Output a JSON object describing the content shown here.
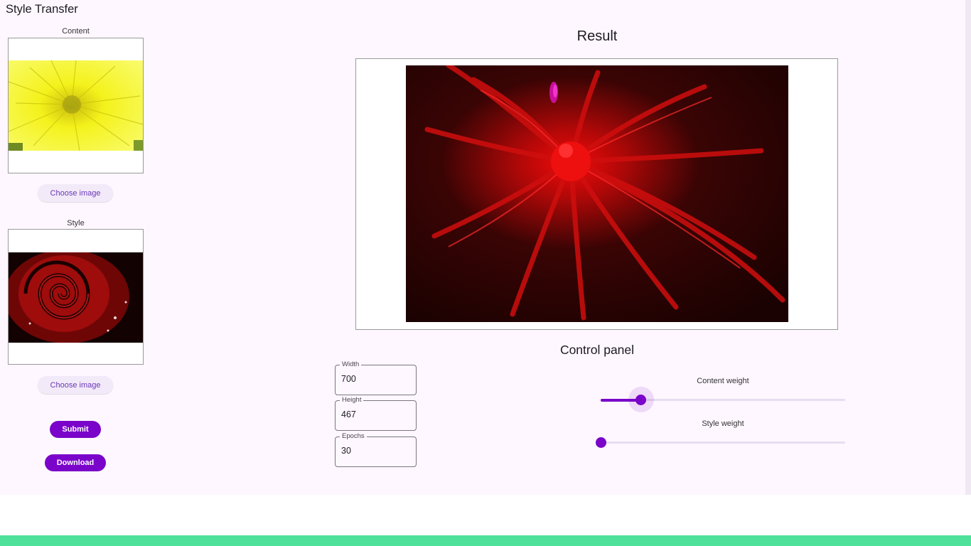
{
  "app": {
    "title": "Style Transfer"
  },
  "content": {
    "label": "Content",
    "choose_label": "Choose image"
  },
  "style": {
    "label": "Style",
    "choose_label": "Choose image"
  },
  "actions": {
    "submit_label": "Submit",
    "download_label": "Download"
  },
  "result": {
    "title": "Result"
  },
  "control_panel": {
    "title": "Control panel",
    "fields": {
      "width": {
        "label": "Width",
        "value": "700"
      },
      "height": {
        "label": "Height",
        "value": "467"
      },
      "epochs": {
        "label": "Epochs",
        "value": "30"
      }
    },
    "sliders": {
      "content_weight": {
        "label": "Content weight",
        "level": 0.165
      },
      "style_weight": {
        "label": "Style weight",
        "level": 0.0
      }
    }
  },
  "colors": {
    "primary": "#7a04c9",
    "background": "#fef7ff",
    "tonal_button": "#f2eaf8",
    "bottom_bar": "#4fe09a"
  }
}
